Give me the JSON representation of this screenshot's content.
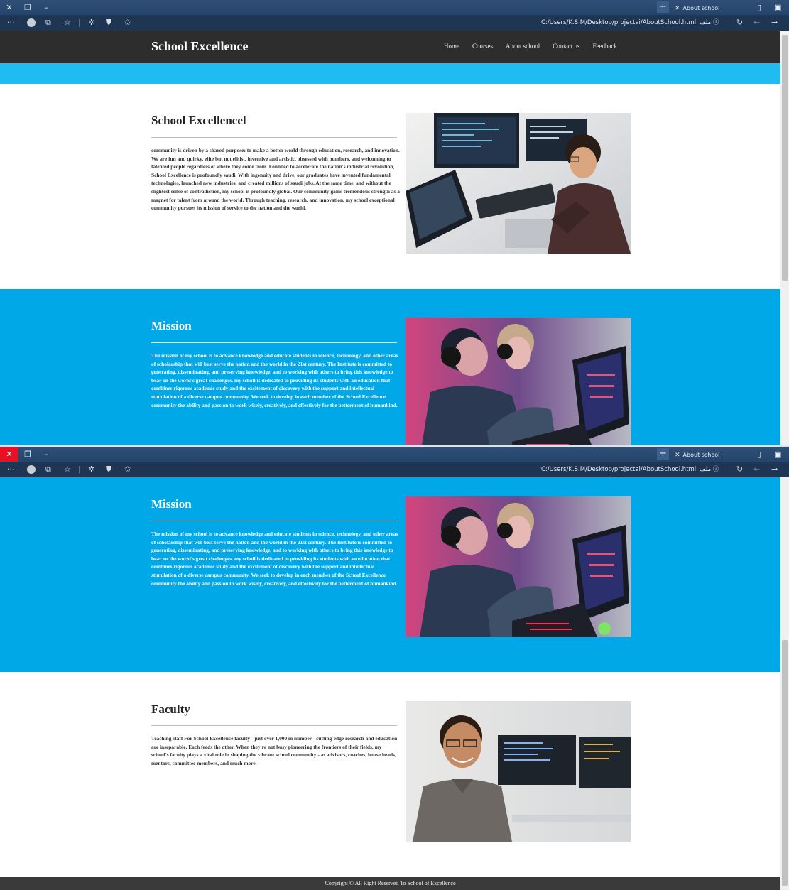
{
  "browser": {
    "tab_title": "About school",
    "url": "C:/Users/K.S.M/Desktop/projectai/AboutSchool.html",
    "file_label": "ملف"
  },
  "nav": {
    "brand": "School Excellence",
    "links": [
      "Home",
      "Courses",
      "About school",
      "Contact us",
      "Feedback"
    ]
  },
  "sections": {
    "about": {
      "title": "School Excellencel",
      "text": "community is driven by a shared purpose: to make a better world through education, research, and innovation. We are fun and quirky, elite but not elitist, inventive and artistic, obsessed with numbers, and welcoming to talented people regardless of where they come from. Founded to accelerate the nation's industrial revolution, School Excellence is profoundly saudi. With ingenuity and drive, our graduates have invented fundamental technologies, launched new industries, and created millions of saudi jobs. At the same time, and without the slightest sense of contradiction, my school is profoundly global. Our community gains tremendous strength as a magnet for talent from around the world. Through teaching, research, and innovation, my school exceptional community pursues its mission of service to the nation and the world."
    },
    "mission": {
      "title": "Mission",
      "text": "The mission of my school is to advance knowledge and educate students in science, technology, and other areas of scholarship that will best serve the nation and the world in the 21st century. The Institute is committed to generating, disseminating, and preserving knowledge, and to working with others to bring this knowledge to bear on the world's great challenges. my scholl is dedicated to providing its students with an education that combines rigorous academic study and the excitement of discovery with the support and intellectual stimulation of a diverse campus community. We seek to develop in each member of the School Excellence community the ability and passion to work wisely, creatively, and effectively for the betterment of humankind."
    },
    "faculty": {
      "title": "Faculty",
      "text": "Teaching staff For School Excellence faculty - just over 1,000 in number - cutting-edge research and education are inseparable. Each feeds the other. When they're not busy pioneering the frontiers of their fields, my school's faculty plays a vital role in shaping the vibrant school community - as advisors, coaches, house heads, mentors, committee members, and much more."
    }
  },
  "footer": {
    "text": "Copyright © All Right Reserved To School of Excellence"
  },
  "icons": {
    "close": "close-icon",
    "restore": "restore-icon",
    "minimize": "minimize-icon",
    "new_tab": "plus-icon"
  },
  "colors": {
    "navbar": "#2d2d2d",
    "strip": "#1fbcf2",
    "blue_section": "#00a8e8",
    "footer": "#3a3a3a"
  }
}
